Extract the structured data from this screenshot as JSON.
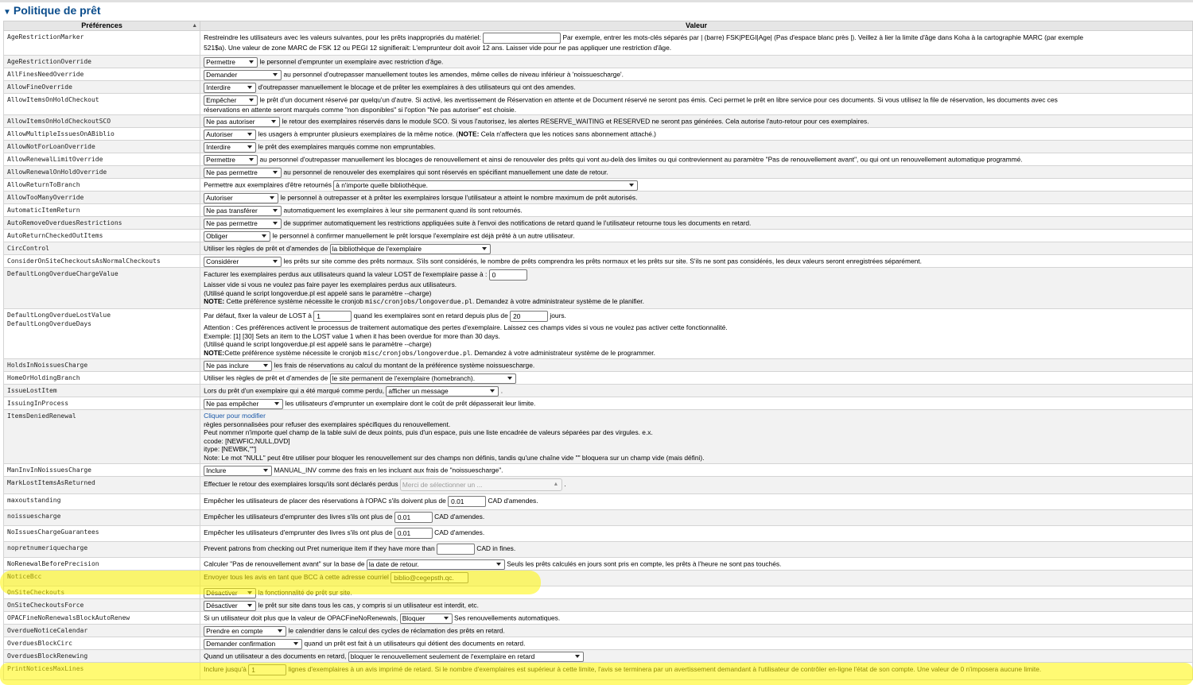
{
  "section_title": "Politique de prêt",
  "headers": {
    "preference": "Préférences",
    "value": "Valeur"
  },
  "rows": [
    {
      "name": "AgeRestrictionMarker",
      "t1": "Restreindre les utilisateurs avec les valeurs suivantes, pour les prêts inappropriés du matériel:",
      "input_value": "",
      "t2": "Par exemple, entrer les mots-clés séparés par | (barre) FSK|PEGI|Age| (Pas d'espace blanc près |). Veillez à lier la limite d'âge dans Koha à la cartographie MARC (par exemple",
      "l2": "521$a). Une valeur de zone MARC de FSK 12 ou PEGI 12 signifierait: L'emprunteur doit avoir 12 ans. Laisser vide pour ne pas appliquer une restriction d'âge."
    },
    {
      "name": "AgeRestrictionOverride",
      "select": "Permettre",
      "text": "le personnel d'emprunter un exemplaire avec restriction d'âge."
    },
    {
      "name": "AllFinesNeedOverride",
      "select": "Demander",
      "text": "au personnel d'outrepasser manuellement toutes les amendes, même celles de niveau inférieur à 'noissuescharge'."
    },
    {
      "name": "AllowFineOverride",
      "select": "Interdire",
      "text": "d'outrepasser manuellement le blocage et de prêter les exemplaires à des utilisateurs qui ont des amendes."
    },
    {
      "name": "AllowItemsOnHoldCheckout",
      "select": "Empêcher",
      "text": "le prêt d'un document réservé par quelqu'un d'autre. Si activé, les avertissement de Réservation en attente et de Document réservé ne seront pas émis. Ceci permet le prêt en libre service pour ces documents. Si vous utilisez la file de réservation, les documents avec ces",
      "l2": "réservations en attente seront marqués comme \"non disponibles\" si l'option \"Ne pas autoriser\" est choisie."
    },
    {
      "name": "AllowItemsOnHoldCheckoutSCO",
      "select": "Ne pas autoriser",
      "text": "le retour des exemplaires réservés dans le module SCO. Si vous l'autorisez, les alertes RESERVE_WAITING et RESERVED ne seront pas générées. Cela autorise l'auto-retour pour ces exemplaires."
    },
    {
      "name": "AllowMultipleIssuesOnABiblio",
      "select": "Autoriser",
      "t1": "les usagers à emprunter plusieurs exemplaires de la même notice. (",
      "note": "NOTE:",
      "t2": " Cela n'affectera que les notices sans abonnement attaché.)"
    },
    {
      "name": "AllowNotForLoanOverride",
      "select": "Interdire",
      "text": "le prêt des exemplaires marqués comme non empruntables."
    },
    {
      "name": "AllowRenewalLimitOverride",
      "select": "Permettre",
      "text": "au personnel d'outrepasser manuellement les blocages de renouvellement et ainsi de renouveler des prêts qui vont au-delà des limites ou qui contreviennent au paramètre \"Pas de renouvellement avant\", ou qui ont un renouvellement automatique programmé."
    },
    {
      "name": "AllowRenewalOnHoldOverride",
      "select": "Ne pas permettre",
      "text": "au personnel de renouveler des exemplaires qui sont réservés en spécifiant manuellement une date de retour."
    },
    {
      "name": "AllowReturnToBranch",
      "t1": "Permettre aux exemplaires d'être retournés",
      "select": "à n'importe quelle bibliothèque."
    },
    {
      "name": "AllowTooManyOverride",
      "select": "Autoriser",
      "text": "le personnel à outrepasser et à prêter les exemplaires lorsque l'utilisateur a atteint le nombre maximum de prêt autorisés."
    },
    {
      "name": "AutomaticItemReturn",
      "select": "Ne pas transférer",
      "text": "automatiquement les exemplaires à leur site permanent quand ils sont retournés."
    },
    {
      "name": "AutoRemoveOverduesRestrictions",
      "select": "Ne pas permettre",
      "text": "de supprimer automatiquement les restrictions appliquées suite à l'envoi des notifications de retard quand le l'utilisateur retourne tous les documents en retard."
    },
    {
      "name": "AutoReturnCheckedOutItems",
      "select": "Obliger",
      "text": "le personnel à confirmer manuellement le prêt lorsque l'exemplaire est déjà prêté à un autre utilisateur."
    },
    {
      "name": "CircControl",
      "t1": "Utiliser les règles de prêt et d'amendes de",
      "select": "la bibliothèque de l'exemplaire"
    },
    {
      "name": "ConsiderOnSiteCheckoutsAsNormalCheckouts",
      "select": "Considérer",
      "text": "les prêts sur site comme des prêts normaux. S'ils sont considérés, le nombre de prêts comprendra les prêts normaux et les prêts sur site. S'ils ne sont pas considérés, les deux valeurs seront enregistrées séparément."
    },
    {
      "name": "DefaultLongOverdueChargeValue",
      "t1": "Facturer les exemplaires perdus aux utilisateurs quand la valeur LOST de l'exemplaire passe à :",
      "input_value": "0",
      "l2": "Laisser vide si vous ne voulez pas faire payer les exemplaires perdus aux utilisateurs.",
      "l3": "(Utilisé quand le script longoverdue.pl est appelé sans le paramètre --charge)",
      "note": "NOTE:",
      "l4a": " Cette préférence système nécessite le cronjob ",
      "code": "misc/cronjobs/longoverdue.pl",
      "l4b": ". Demandez à votre administrateur système de le planifier."
    },
    {
      "name": "DefaultLongOverdueLostValue",
      "name2": "DefaultLongOverdueDays",
      "t1": "Par défaut, fixer la valeur de LOST à",
      "input1": "1",
      "t2": "quand les exemplaires sont en retard depuis plus de",
      "input2": "20",
      "t3": "jours.",
      "l2": "Attention : Ces préférences activent le processus de traitement automatique des pertes d'exemplaire. Laissez ces champs vides si vous ne voulez pas activer cette fonctionnalité.",
      "l3": "Exemple: [1] [30] Sets an item to the LOST value 1 when it has been overdue for more than 30 days.",
      "l4": "(Utilisé quand le script longoverdue.pl est appelé sans le paramètre --charge)",
      "note": "NOTE:",
      "l5a": "Cette préférence système nécessite le cronjob ",
      "code": "misc/cronjobs/longoverdue.pl",
      "l5b": ". Demandez à votre administrateur système de le programmer."
    },
    {
      "name": "HoldsInNoissuesCharge",
      "select": "Ne pas inclure",
      "text": "les frais de réservations au calcul du montant de la préférence système noissuescharge."
    },
    {
      "name": "HomeOrHoldingBranch",
      "t1": "Utiliser les règles de prêt et d'amendes de",
      "select": "le site permanent de l'exemplaire (homebranch)."
    },
    {
      "name": "IssueLostItem",
      "t1": "Lors du prêt d'un exemplaire qui a été marqué comme perdu,",
      "select": "afficher un message",
      "t2": "."
    },
    {
      "name": "IssuingInProcess",
      "select": "Ne pas empêcher",
      "text": "les utilisateurs d'emprunter un exemplaire dont le coût de prêt dépasserait leur limite."
    },
    {
      "name": "ItemsDeniedRenewal",
      "link": "Cliquer pour modifier",
      "l2": "règles personnalisées pour refuser des exemplaires spécifiques du renouvellement.",
      "l3": "Peut nommer n'importe quel champ de la table suivi de deux points, puis d'un espace, puis une liste encadrée de valeurs séparées par des virgules. e.x.",
      "l4": "ccode: [NEWFIC,NULL,DVD]",
      "l5": "itype: [NEWBK,\"\"]",
      "l6": "Note: Le mot \"NULL\" peut être utiliser pour bloquer les renouvellement sur des champs non définis, tandis qu'une chaîne vide \"\" bloquera sur un champ vide (mais défini)."
    },
    {
      "name": "ManInvInNoissuesCharge",
      "select": "Inclure",
      "text": "MANUAL_INV comme des frais en les incluant aux frais de \"noissuescharge\"."
    },
    {
      "name": "MarkLostItemsAsReturned",
      "t1": "Effectuer le retour des exemplaires lorsqu'ils sont déclarés perdus",
      "select": "Merci de sélectionner un ...",
      "t2": "."
    },
    {
      "name": "maxoutstanding",
      "t1": "Empêcher les utilisateurs de placer des réservations à l'OPAC s'ils doivent plus de",
      "input_value": "0.01",
      "t2": "CAD d'amendes."
    },
    {
      "name": "noissuescharge",
      "t1": "Empêcher les utilisateurs d'emprunter des livres s'ils ont plus de",
      "input_value": "0.01",
      "t2": "CAD d'amendes."
    },
    {
      "name": "NoIssuesChargeGuarantees",
      "t1": "Empêcher les utilisateurs d'emprunter des livres s'ils ont plus de",
      "input_value": "0.01",
      "t2": "CAD d'amendes."
    },
    {
      "name": "nopretnumeriquecharge",
      "t1": "Prevent patrons from checking out Pret numerique item if they have more than",
      "input_value": "",
      "t2": "CAD in fines."
    },
    {
      "name": "NoRenewalBeforePrecision",
      "t1": "Calculer \"Pas de renouvellement avant\" sur la base de",
      "select": "la date de retour.",
      "t2": "Seuls les prêts calculés en jours sont pris en compte, les prêts à l'heure ne sont pas touchés."
    },
    {
      "name": "NoticeBcc",
      "t1": "Envoyer tous les avis en tant que BCC à cette adresse courriel",
      "input_value": "biblio@cegepsth.qc."
    },
    {
      "name": "OnSiteCheckouts",
      "select": "Désactiver",
      "text": "la fonctionnalité de prêt sur site."
    },
    {
      "name": "OnSiteCheckoutsForce",
      "select": "Désactiver",
      "text": "le prêt sur site dans tous les cas, y compris si un utilisateur est interdit, etc."
    },
    {
      "name": "OPACFineNoRenewalsBlockAutoRenew",
      "t1": "Si un utilisateur doit plus que la valeur de OPACFineNoRenewals,",
      "select": "Bloquer",
      "t2": "Ses renouvellements automatiques."
    },
    {
      "name": "OverdueNoticeCalendar",
      "select": "Prendre en compte",
      "text": "le calendrier dans le calcul des cycles de réclamation des prêts en retard."
    },
    {
      "name": "OverduesBlockCirc",
      "select": "Demander confirmation",
      "text": "quand un prêt est fait à un utilisateurs qui détient des documents en retard."
    },
    {
      "name": "OverduesBlockRenewing",
      "t1": "Quand un utilisateur a des documents en retard,",
      "select": "bloquer le renouvellement seulement de l'exemplaire en retard"
    },
    {
      "name": "PrintNoticesMaxLines",
      "t1": "Inclure jusqu'à",
      "input_value": "1",
      "t2": "lignes d'exemplaires à un avis imprimé de retard. Si le nombre d'exemplaires est supérieur à cette limite, l'avis se terminera par un avertissement demandant à l'utilisateur de contrôler en-ligne l'état de son compte. Une valeur de 0 n'imposera aucune limite."
    }
  ]
}
